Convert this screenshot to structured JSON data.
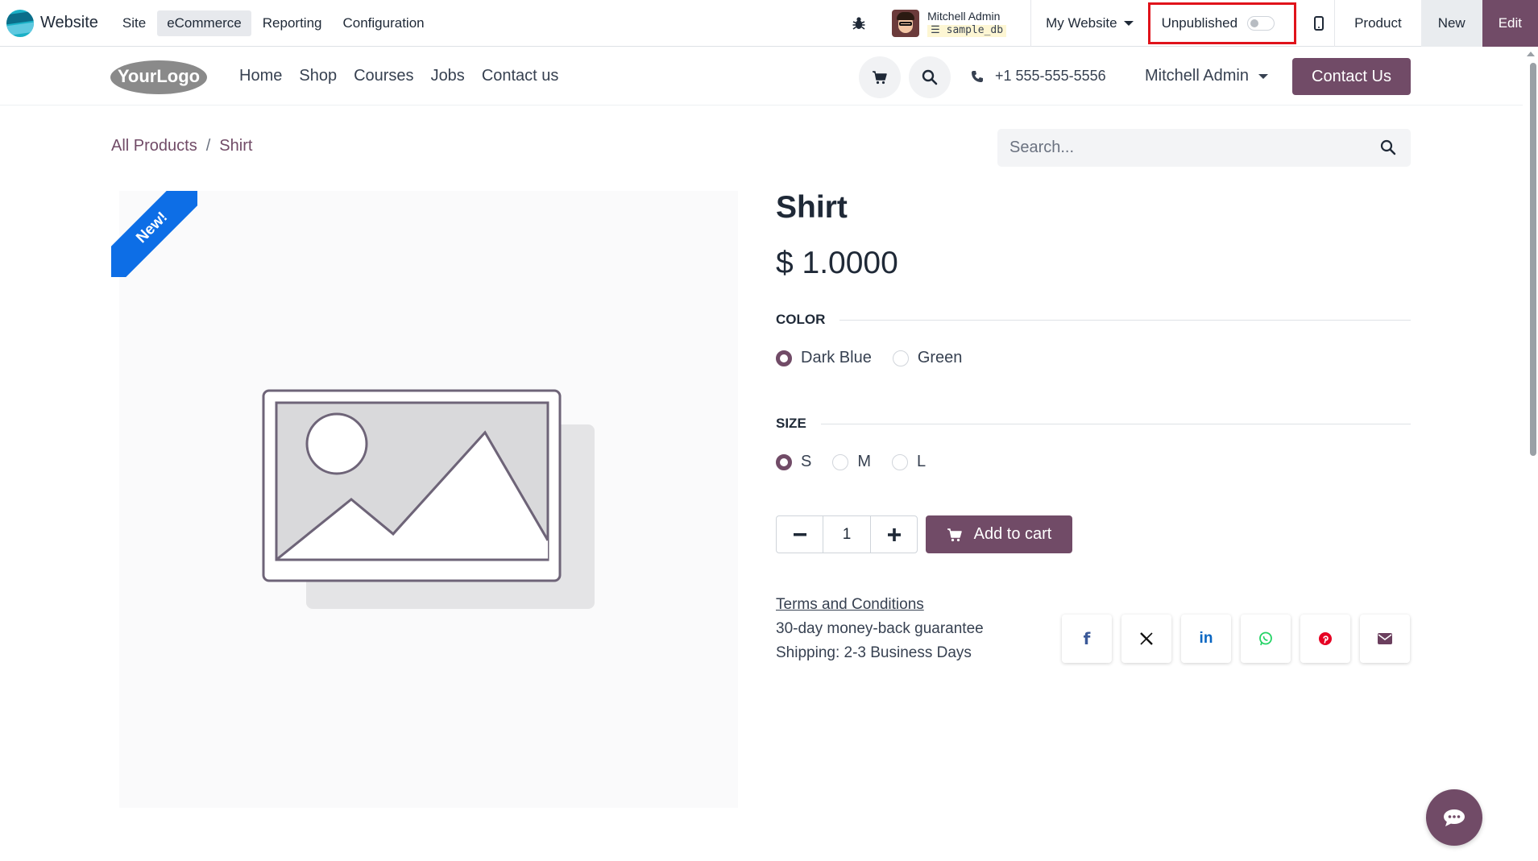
{
  "admin_bar": {
    "app_name": "Website",
    "menu": [
      {
        "label": "Site",
        "active": false
      },
      {
        "label": "eCommerce",
        "active": true
      },
      {
        "label": "Reporting",
        "active": false
      },
      {
        "label": "Configuration",
        "active": false
      }
    ],
    "user_name": "Mitchell Admin",
    "database": "sample_db",
    "website_switcher": "My Website",
    "publish_label": "Unpublished",
    "published": false,
    "product_label": "Product",
    "new_label": "New",
    "edit_label": "Edit"
  },
  "header": {
    "logo_text": "YourLogo",
    "nav": [
      "Home",
      "Shop",
      "Courses",
      "Jobs",
      "Contact us"
    ],
    "phone": "+1 555-555-5556",
    "user": "Mitchell Admin",
    "contact_button": "Contact Us"
  },
  "breadcrumb": {
    "parent": "All Products",
    "current": "Shirt"
  },
  "search": {
    "placeholder": "Search..."
  },
  "product": {
    "ribbon": "New!",
    "name": "Shirt",
    "price": "$ 1.0000",
    "attributes": [
      {
        "name": "COLOR",
        "options": [
          {
            "label": "Dark Blue",
            "selected": true
          },
          {
            "label": "Green",
            "selected": false
          }
        ]
      },
      {
        "name": "SIZE",
        "options": [
          {
            "label": "S",
            "selected": true
          },
          {
            "label": "M",
            "selected": false
          },
          {
            "label": "L",
            "selected": false
          }
        ]
      }
    ],
    "quantity": "1",
    "add_to_cart": "Add to cart",
    "terms": "Terms and Conditions",
    "guarantee": "30-day money-back guarantee",
    "shipping": "Shipping: 2-3 Business Days"
  },
  "share": [
    {
      "icon": "facebook-icon",
      "glyph": "f",
      "color": "#3b5998"
    },
    {
      "icon": "x-twitter-icon",
      "glyph": "X",
      "color": "#111111"
    },
    {
      "icon": "linkedin-icon",
      "glyph": "in",
      "color": "#0a66c2"
    },
    {
      "icon": "whatsapp-icon",
      "glyph": "",
      "color": "#25d366"
    },
    {
      "icon": "pinterest-icon",
      "glyph": "",
      "color": "#e60023"
    },
    {
      "icon": "email-icon",
      "glyph": "",
      "color": "#714b67"
    }
  ],
  "colors": {
    "brand": "#714b67",
    "ribbon": "#0d6ee6",
    "highlight": "#e0131b"
  }
}
